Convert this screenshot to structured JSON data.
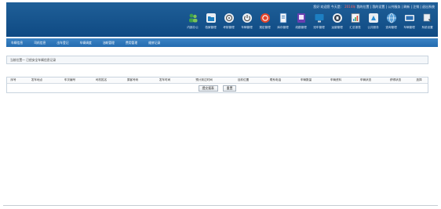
{
  "header": {
    "top_links": [
      "您好 欢迎您",
      "今天是：",
      "2014年",
      "我的位置",
      "我的设置",
      "公共服务",
      "刷新",
      "注销",
      "退出系统"
    ],
    "modules": [
      {
        "label": "内部办公",
        "icon": "people-icon",
        "color": "#3fa24a"
      },
      {
        "label": "档案管理",
        "icon": "folder-icon",
        "color": "#1d7fc2"
      },
      {
        "label": "考核管理",
        "icon": "dial-icon",
        "color": "#e9eef3"
      },
      {
        "label": "车辆管理",
        "icon": "power-icon",
        "color": "#e9eef3"
      },
      {
        "label": "规定管理",
        "icon": "stop-icon",
        "color": "#e3452b"
      },
      {
        "label": "库存管理",
        "icon": "document-icon",
        "color": "#e9eef3"
      },
      {
        "label": "线路管理",
        "icon": "book-icon",
        "color": "#6a3fb0"
      },
      {
        "label": "班车管理",
        "icon": "monitor-icon",
        "color": "#1d7fc2"
      },
      {
        "label": "运营管理",
        "icon": "badge-icon",
        "color": "#e9eef3"
      },
      {
        "label": "汇总报表",
        "icon": "report-icon",
        "color": "#e9eef3"
      },
      {
        "label": "公共服务",
        "icon": "world-icon",
        "color": "#2b8fd6"
      },
      {
        "label": "查询管理",
        "icon": "globe-icon",
        "color": "#e9eef3"
      },
      {
        "label": "车辆管理",
        "icon": "truck-icon",
        "color": "#2b6fb3"
      },
      {
        "label": "系统设置",
        "icon": "settings-icon",
        "color": "#e9eef3"
      }
    ]
  },
  "nav": {
    "tabs": [
      "车辆信息",
      "司机信息",
      "出车登记",
      "车辆调度",
      "油耗管理",
      "费用管理",
      "维修记录"
    ]
  },
  "info": {
    "text": "当前位置一 已经安全车辆信息记录"
  },
  "table": {
    "columns": [
      "序号",
      "发车地点",
      "车次编号",
      "司机姓名",
      "乘客号码",
      "发车时间",
      "预计到达时间",
      "目前位置",
      "联系电话",
      "车辆数量",
      "车辆资料",
      "车辆状态",
      "获得状态",
      "选择"
    ],
    "buttons": {
      "submit": "提交报表",
      "reset": "重置"
    }
  }
}
